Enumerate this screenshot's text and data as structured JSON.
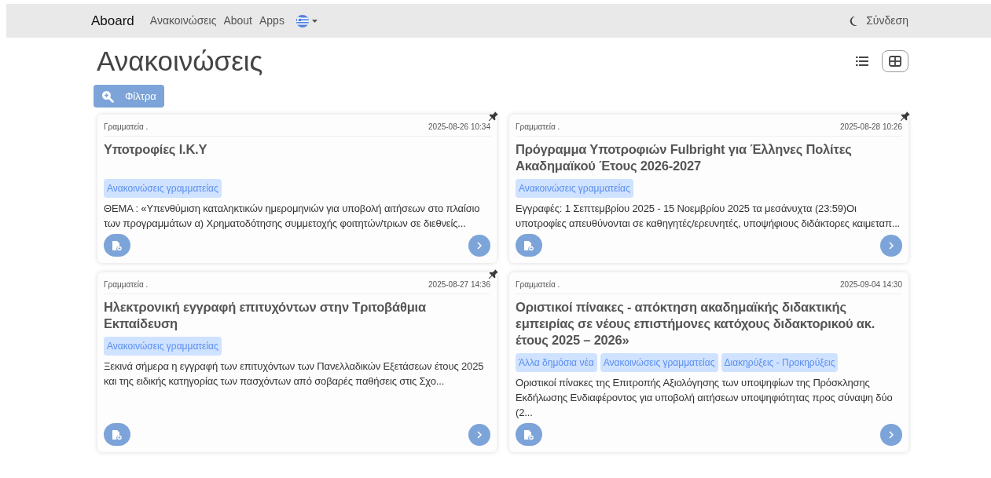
{
  "navbar": {
    "brand": "Aboard",
    "links": [
      "Ανακοινώσεις",
      "About",
      "Apps"
    ],
    "login": "Σύνδεση"
  },
  "page": {
    "title": "Ανακοινώσεις",
    "filter_button": "Φίλτρα",
    "views": [
      {
        "kind": "list",
        "selected": false
      },
      {
        "kind": "grid",
        "selected": true
      }
    ]
  },
  "cards": [
    {
      "source": "Γραμματεία .",
      "date": "2025-08-26 10:34",
      "title": "Υποτροφίες Ι.Κ.Υ",
      "pinned": true,
      "tags": [
        "Ανακοινώσεις γραμματείας"
      ],
      "excerpt": "ΘΕΜΑ : «Υπενθύμιση καταληκτικών ημερομηνιών για υποβολή αιτήσεων στο πλαίσιο των προγραμμάτων α) Χρηματοδότησης συμμετοχής φοιτητών/τριων σε διεθνείς..."
    },
    {
      "source": "Γραμματεία .",
      "date": "2025-08-28 10:26",
      "title": "Πρόγραμμα Υποτροφιών Fulbright για Έλληνες Πολίτες Ακαδημαϊκού Έτους 2026-2027",
      "pinned": true,
      "tags": [
        "Ανακοινώσεις γραμματείας"
      ],
      "excerpt": "Εγγραφές: 1 Σεπτεμβρίου 2025 - 15 Νοεμβρίου 2025 τα μεσάνυχτα (23:59)Οι υποτροφίες απευθύνονται σε καθηγητές/ερευνητές, υποψήφιους διδάκτορες καιμεταπ..."
    },
    {
      "source": "Γραμματεία .",
      "date": "2025-08-27 14:36",
      "title": "Ηλεκτρονική εγγραφή επιτυχόντων στην Τριτοβάθμια Εκπαίδευση",
      "pinned": true,
      "tags": [
        "Ανακοινώσεις γραμματείας"
      ],
      "excerpt": "Ξεκινά σήμερα η εγγραφή των επιτυχόντων των Πανελλαδικών Εξετάσεων έτους 2025 και της ειδικής κατηγορίας των πασχόντων από σοβαρές παθήσεις στις Σχο..."
    },
    {
      "source": "Γραμματεία .",
      "date": "2025-09-04 14:30",
      "title": "Οριστικοί πίνακες - απόκτηση ακαδημαϊκής διδακτικής εμπειρίας σε νέους επιστήμονες κατόχους διδακτορικού ακ. έτους 2025 – 2026»",
      "pinned": false,
      "tags": [
        "Άλλα δημόσια νέα",
        "Ανακοινώσεις γραμματείας",
        "Διακηρύξεις - Προκηρύξεις"
      ],
      "excerpt": "Οριστικοί πίνακες της Επιτροπής Αξιολόγησης των υποψηφίων της Πρόσκλησης Εκδήλωσης Ενδιαφέροντος για υποβολή αιτήσεων υποψηφιότητας προς σύναψη δύο (2..."
    }
  ]
}
